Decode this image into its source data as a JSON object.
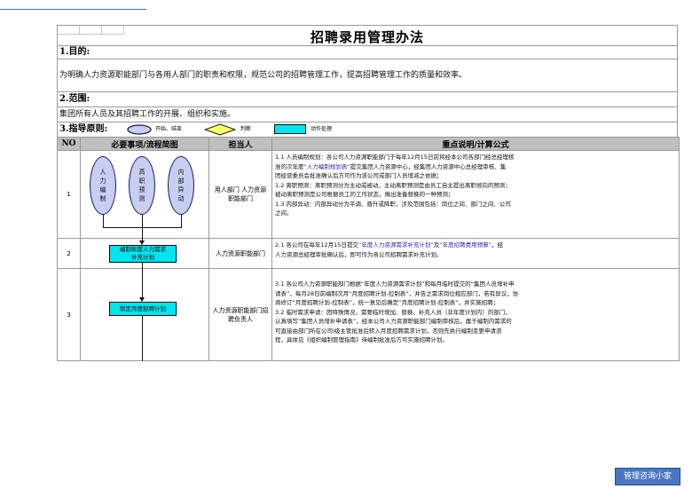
{
  "title": "招聘录用管理办法",
  "sections": {
    "purpose_heading": "1.目的:",
    "purpose_text": "为明确人力资源职能部门与各用人部门的职责和权限，规范公司的招聘管理工作，提高招聘管理工作的质量和效率。",
    "scope_heading": "2.范围:",
    "scope_text": "集团所有人员及其招聘工作的开展、组织和实施。",
    "principle_heading": "3.指导原则:"
  },
  "legend": {
    "start_end": "开始、结束",
    "decision": "判断",
    "action": "动作处理"
  },
  "table": {
    "headers": [
      "NO",
      "必要事项/流程简图",
      "担当人",
      "重点说明/计算公式"
    ],
    "rows": [
      {
        "no": "1",
        "flow": [
          "人力编制",
          "高职预测",
          "内部异动"
        ],
        "owner": "用人部门 人力资源职能部门",
        "desc_lines": [
          "1.1 人员编制规划：各公司人力资源职能部门于每年12月15日前将经本公司各部门经总经理核",
          "准的次年度“人力编制规划表”提交集团人力资源中心，经集团人力资源中心总经理审核、集",
          "团经营委员会批准确认后方可作为该公司或部门人员增减之依据；",
          "1.2 离职预测：离职预测分为主动或被动，主动离职预测是由员工自主提出离职倾向的预测；",
          "被动离职预测是公司根据员工的工作状态，做出准备替换的一种预测；",
          "1.3 内部异动：内部异动分为平调、晋升或降职，涉及范围包括：岗位之间、部门之间、公司",
          "之间。"
        ]
      },
      {
        "no": "2",
        "flow": [
          "编制年度人力需求补充计划"
        ],
        "owner": "人力资源职能部门",
        "desc_lines": [
          "2.1 各公司在每年12月15日提交“年度人力资源需求补充计划”及“年度招聘费用预算”，经",
          "人力资源总经理审批确认后，即可作为各公司招聘需求补充计划。"
        ]
      },
      {
        "no": "3",
        "flow": [
          "制定月度招聘计划"
        ],
        "owner": "人力资源职能部门招聘负责人",
        "desc_lines": [
          "3.1 各公司人力资源职能部门根据“年度人力资源需求计划”和每月临时提交的“集团人员增补申",
          "请表”，每月28日前编制次月“月度招聘计划-控制表”，并告之需求岗位相应部门，若有异议，协",
          "商修订“月度招聘计划-控制表”，统一意见后确定“月度招聘计划-控制表”，并实施招聘；",
          "3.2 临时需求申请：因特殊情况，需要临时增加、替换、补充人员（非年度计划内）的部门，",
          "认真填写“集团人员增补申请表”，经本公司人力资源职能部门编制审核后，属于编制内需求的",
          "可直接由部门所在公司I级主管批准后转入月度招聘需求计划，否则先执行编制变更申请流",
          "程，具体见《组织编制管理指南》待编制批准后方可实施招聘计划。"
        ]
      }
    ]
  },
  "consult_button": "管理咨询小家",
  "colors": {
    "accent": "#4a76c0",
    "flow_rect": "#00e5ee",
    "ellipse_fill": "#c8cdf2",
    "diamond": "#ffff66",
    "header_gray": "#bfbfbf"
  }
}
